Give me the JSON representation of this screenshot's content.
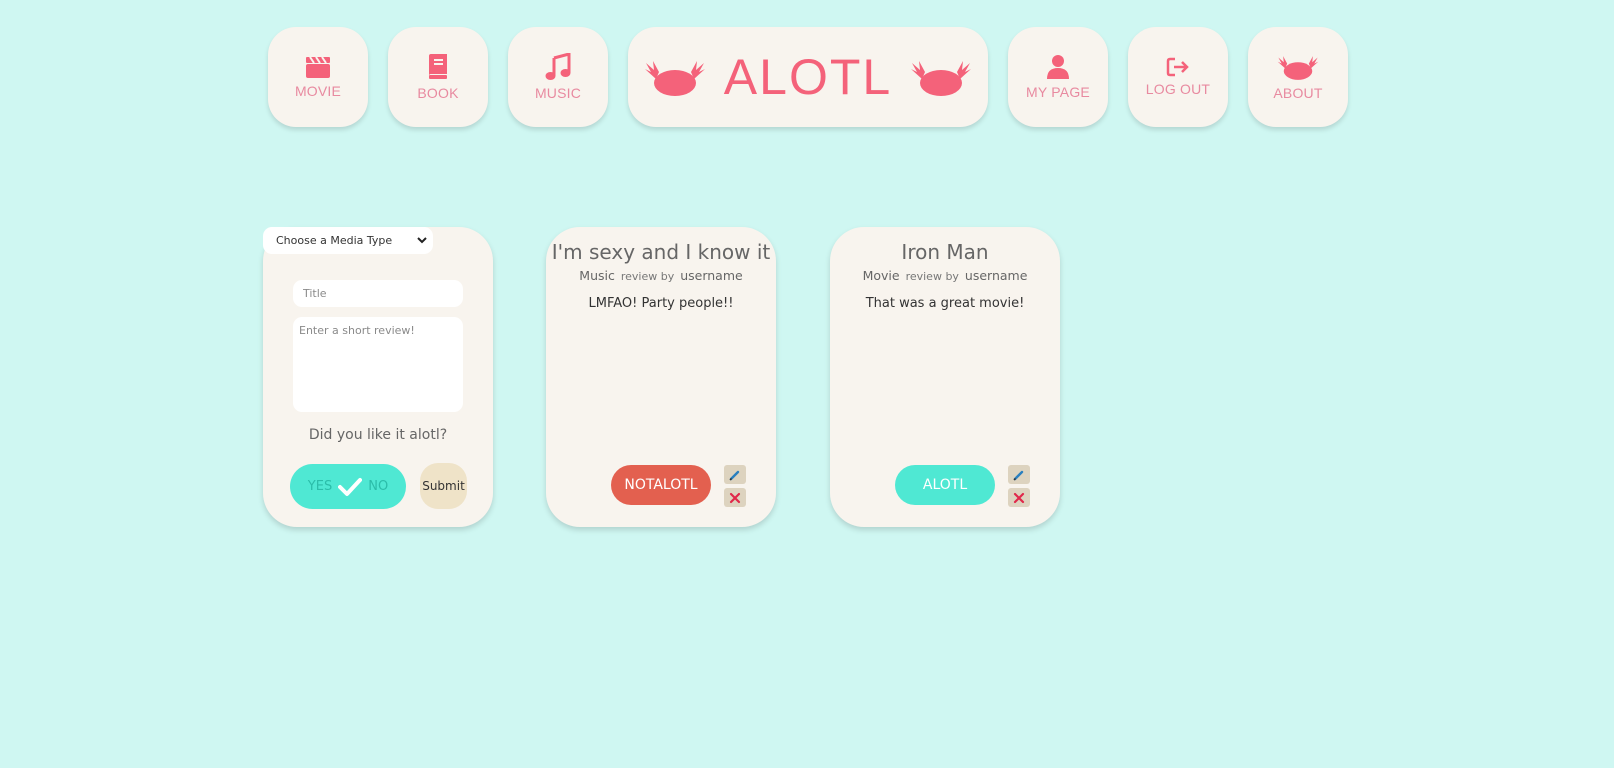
{
  "nav": {
    "movie": "MOVIE",
    "book": "BOOK",
    "music": "MUSIC",
    "logo": "ALOTL",
    "my_page": "MY PAGE",
    "log_out": "LOG OUT",
    "about": "ABOUT"
  },
  "form": {
    "media_type_selected": "Choose a Media Type",
    "title_placeholder": "Title",
    "review_placeholder": "Enter a short review!",
    "question": "Did you like it alotl?",
    "toggle_yes": "YES",
    "toggle_no": "NO",
    "submit_label": "Submit"
  },
  "reviews": [
    {
      "title": "I'm sexy and I know it",
      "media": "Music",
      "review_by": "review by",
      "user": "username",
      "body": "LMFAO! Party people!!",
      "verdict": "NOTALOTL"
    },
    {
      "title": "Iron Man",
      "media": "Movie",
      "review_by": "review by",
      "user": "username",
      "body": "That was a great movie!",
      "verdict": "ALOTL"
    }
  ],
  "colors": {
    "background": "#cff7f2",
    "panel": "#f8f4ee",
    "accent": "#f4627a",
    "alotl": "#4fe8d3",
    "notalotl": "#e3604f"
  },
  "icons": {
    "movie": "clapperboard-icon",
    "book": "book-icon",
    "music": "music-note-icon",
    "my_page": "user-icon",
    "log_out": "sign-out-icon",
    "about": "axolotl-icon",
    "edit": "pencil-icon",
    "delete": "close-icon"
  }
}
